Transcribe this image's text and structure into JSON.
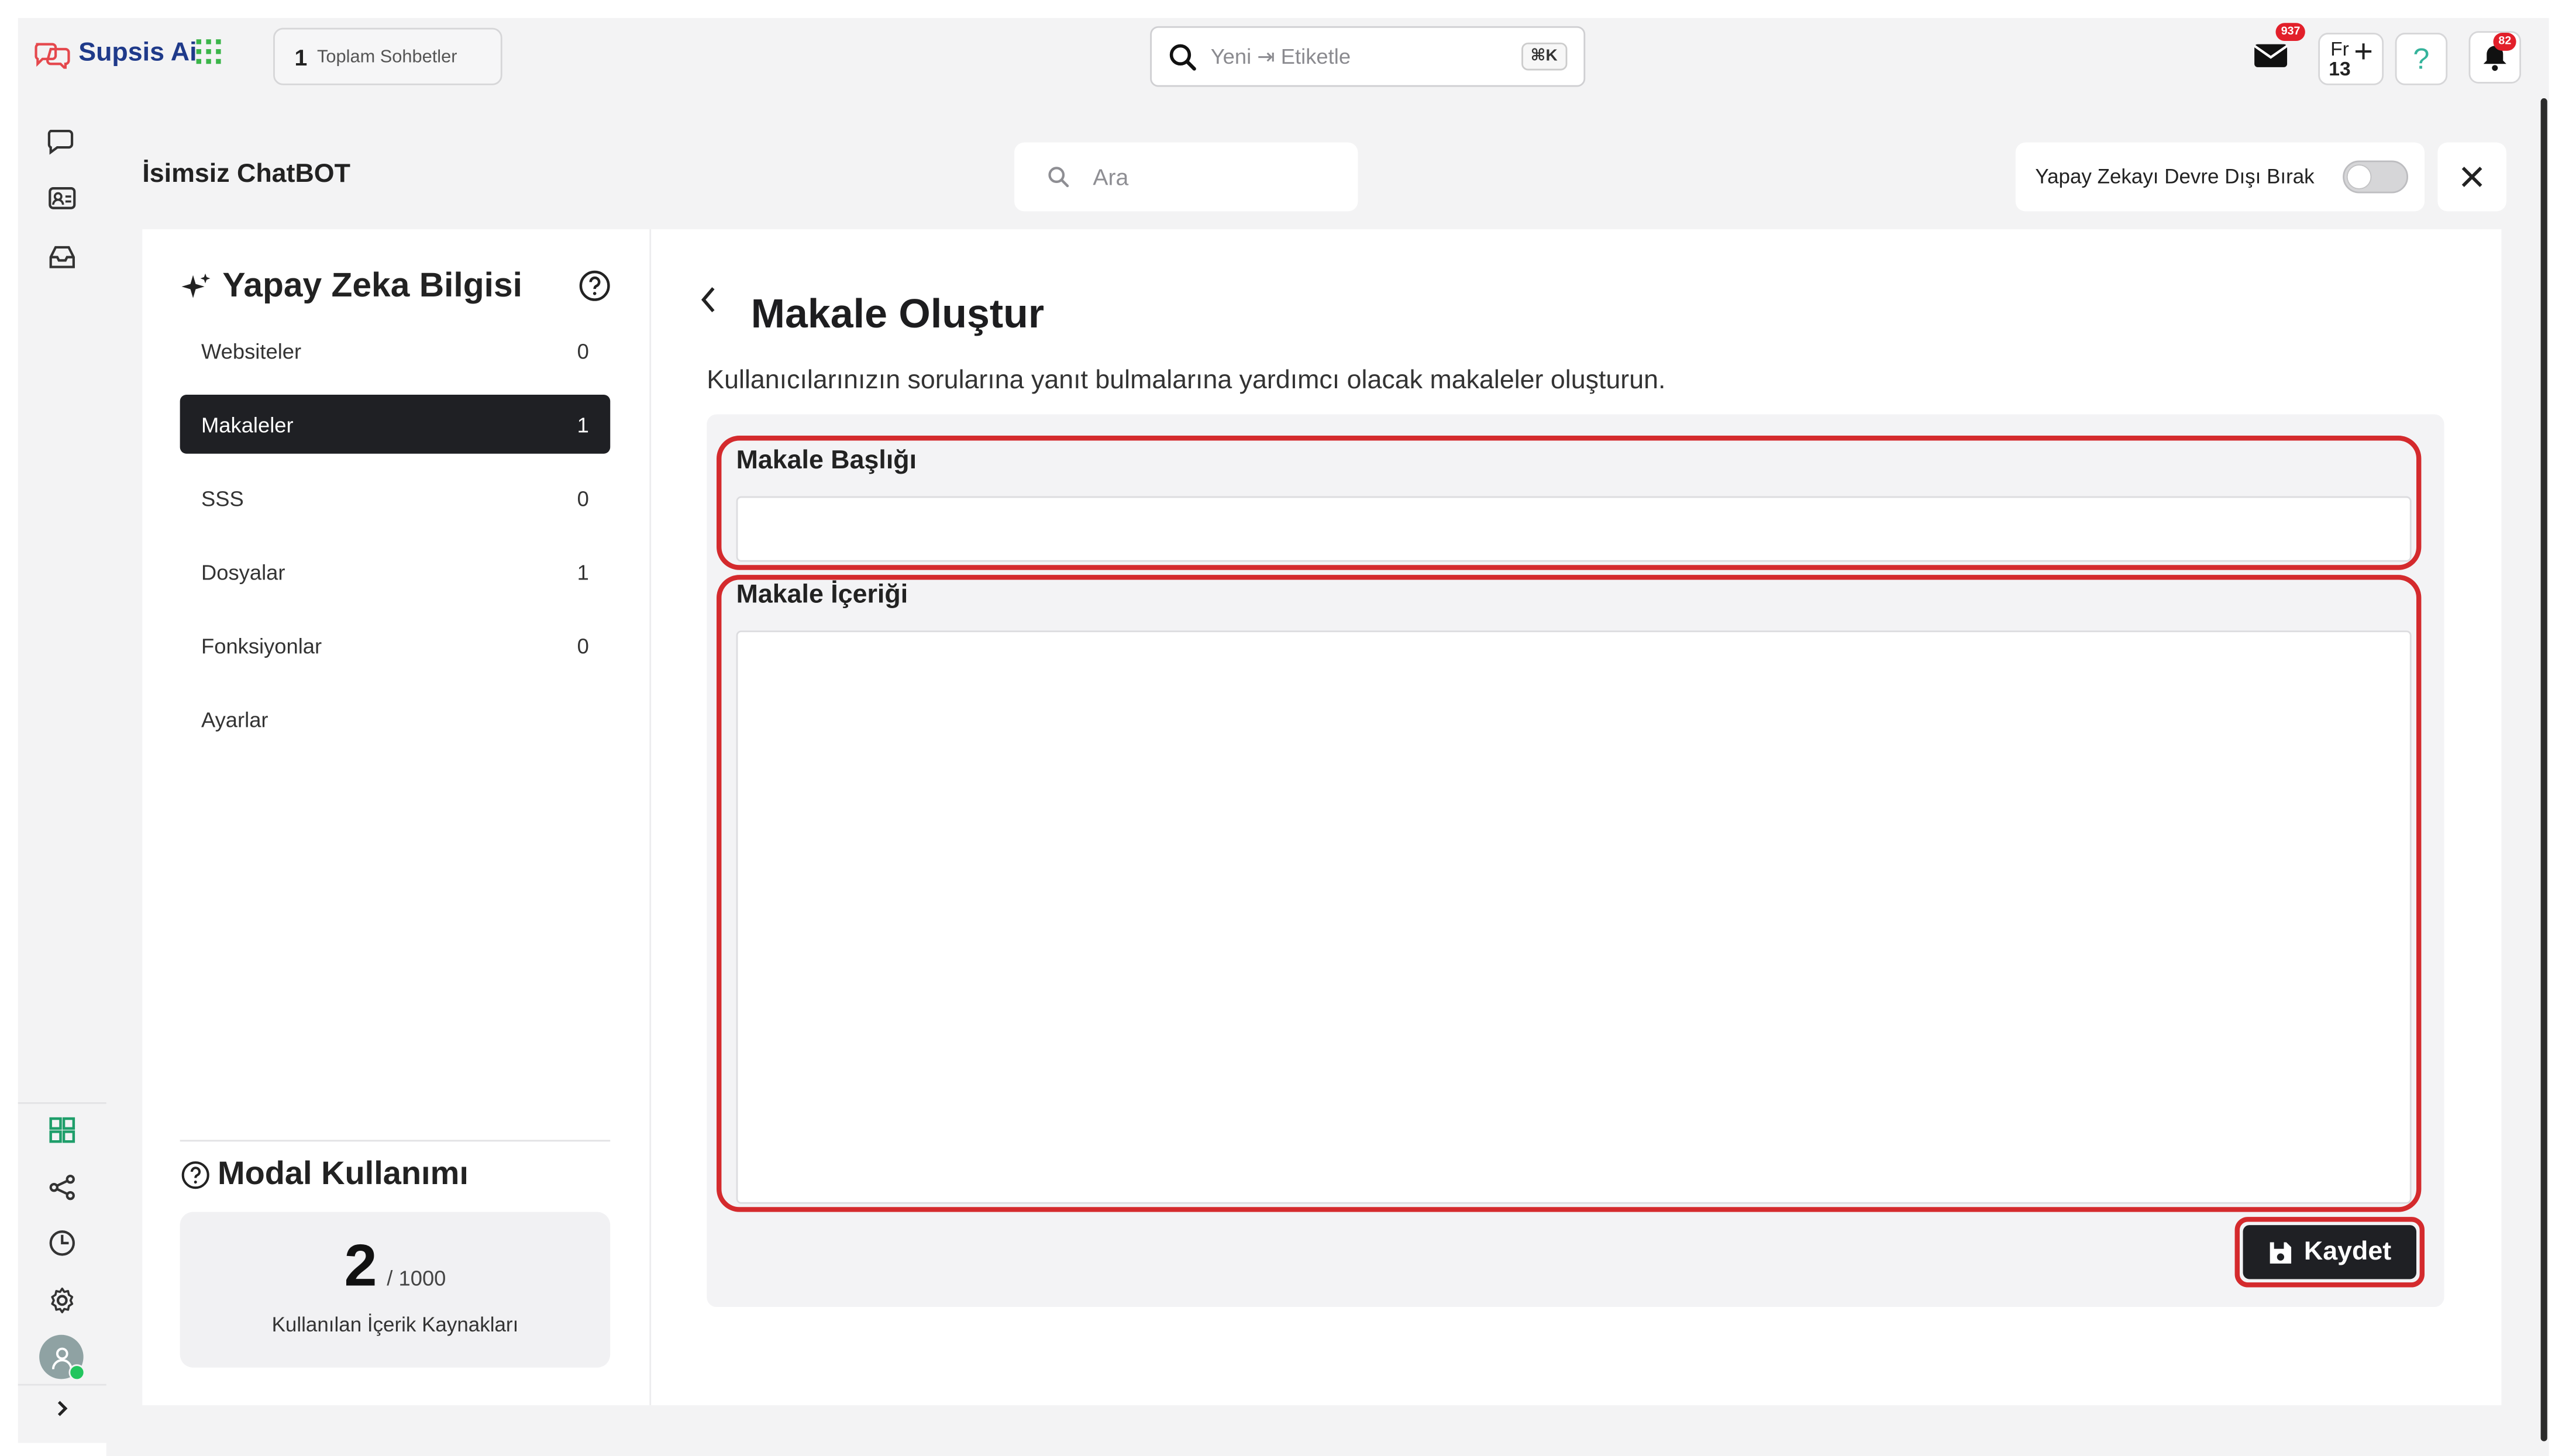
{
  "topbar": {
    "brand": "Supsis Ai",
    "conversations_count": "1",
    "conversations_label": "Toplam Sohbetler",
    "search_placeholder": "Yeni ⇥ Etiketle",
    "search_shortcut": "⌘K",
    "mail_badge": "937",
    "fr_label": "Fr",
    "fr_count": "13",
    "notif_badge": "82"
  },
  "header": {
    "title": "İsimsiz ChatBOT",
    "search_placeholder": "Ara",
    "ai_toggle_label": "Yapay Zekayı Devre Dışı Bırak",
    "ai_toggle_on": false
  },
  "knowledge": {
    "title": "Yapay Zeka Bilgisi",
    "items": [
      {
        "label": "Websiteler",
        "count": "0",
        "active": false
      },
      {
        "label": "Makaleler",
        "count": "1",
        "active": true
      },
      {
        "label": "SSS",
        "count": "0",
        "active": false
      },
      {
        "label": "Dosyalar",
        "count": "1",
        "active": false
      },
      {
        "label": "Fonksiyonlar",
        "count": "0",
        "active": false
      },
      {
        "label": "Ayarlar",
        "count": "",
        "active": false
      }
    ]
  },
  "usage": {
    "title": "Modal Kullanımı",
    "used": "2",
    "limit": "/ 1000",
    "label": "Kullanılan İçerik Kaynakları"
  },
  "form": {
    "title": "Makale Oluştur",
    "description": "Kullanıcılarınızın sorularına yanıt bulmalarına yardımcı olacak makaleler oluşturun.",
    "title_label": "Makale Başlığı",
    "title_value": "",
    "content_label": "Makale İçeriği",
    "content_value": "",
    "save_label": "Kaydet"
  },
  "colors": {
    "highlight": "#d42a2d",
    "active_nav": "#1f2024",
    "brand": "#1f3a8a",
    "online": "#22c55e"
  }
}
